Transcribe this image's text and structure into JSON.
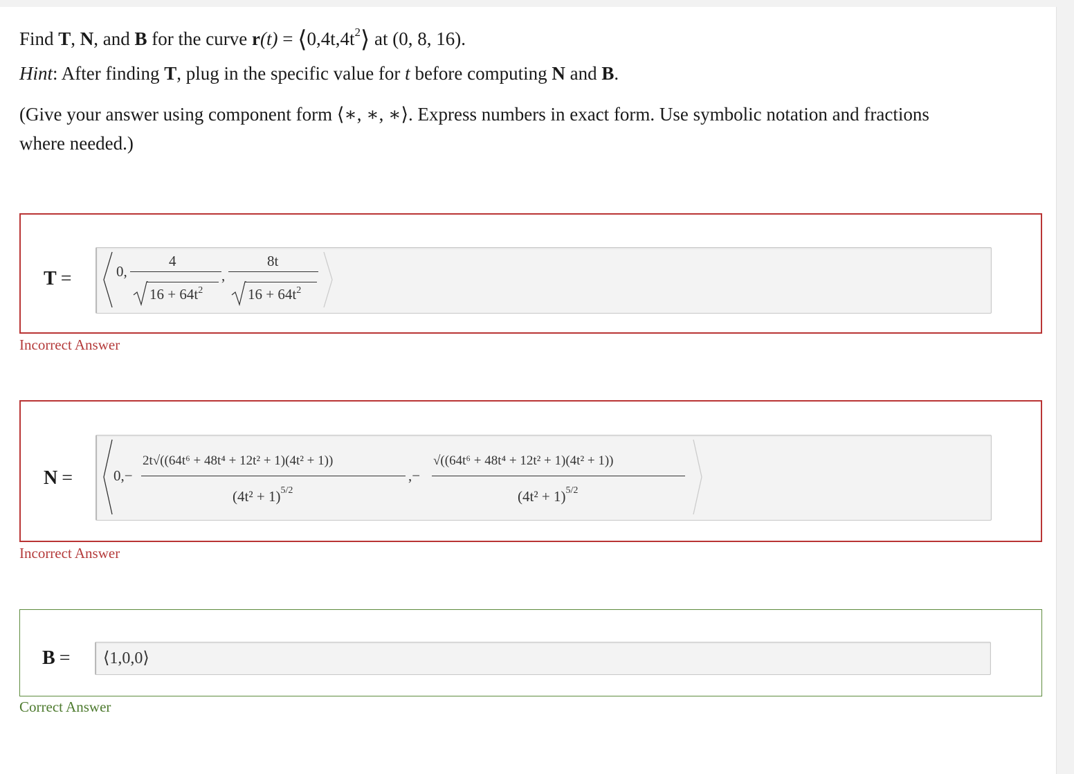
{
  "question": {
    "line1": {
      "find": "Find ",
      "T": "T",
      "c1": ", ",
      "N": "N",
      "c2": ", and ",
      "B": "B",
      "mid": " for the curve ",
      "r": "r",
      "paren_t": "(t)",
      "eq": " = ",
      "vec_open": "⟨",
      "vec_body": "0,4t,4t",
      "vec_exp": "2",
      "vec_close": "⟩",
      "at": " at (0, 8, 16)."
    },
    "hint": {
      "label": "Hint",
      "t1": ": After finding ",
      "T": "T",
      "t2": ", plug in the specific value for ",
      "t_var": "t",
      "t3": " before computing ",
      "N": "N",
      "t4": " and ",
      "B": "B",
      "t5": "."
    },
    "instructions_1": "(Give your answer using component form ⟨∗, ∗, ∗⟩. Express numbers in exact form. Use symbolic notation and fractions",
    "instructions_2": "where needed.)"
  },
  "answers": {
    "T": {
      "label": "T",
      "eq": "=",
      "feedback": "Incorrect Answer",
      "expr": {
        "zero": "0,",
        "num1": "4",
        "den1": "16 + 64t",
        "den1_exp": "2",
        "comma": ",",
        "num2": "8t",
        "den2": "16 + 64t",
        "den2_exp": "2"
      }
    },
    "N": {
      "label": "N",
      "eq": "=",
      "feedback": "Incorrect Answer",
      "expr": {
        "zero": "0,−",
        "num1": "2t√((64t⁶ + 48t⁴ + 12t² + 1)(4t² + 1))",
        "den1": "(4t² + 1)",
        "den1_exp": "5/2",
        "sep": ",−",
        "num2": "√((64t⁶ + 48t⁴ + 12t² + 1)(4t² + 1))",
        "den2": "(4t² + 1)",
        "den2_exp": "5/2"
      }
    },
    "B": {
      "label": "B",
      "eq": "=",
      "value": "⟨1,0,0⟩",
      "feedback": "Correct Answer"
    }
  },
  "colors": {
    "incorrect": "#b93434",
    "correct": "#5d8b3d",
    "field_bg": "#f3f3f3"
  }
}
